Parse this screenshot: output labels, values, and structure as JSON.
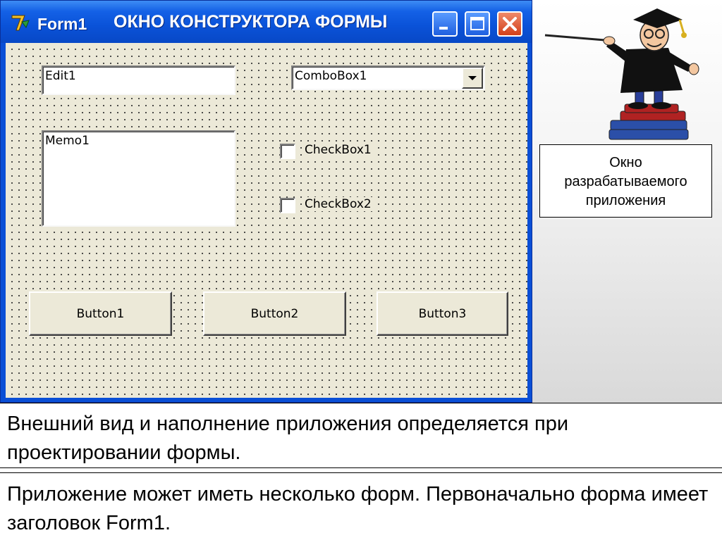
{
  "window": {
    "title": "Form1",
    "caption": "ОКНО КОНСТРУКТОРА ФОРМЫ",
    "colors": {
      "titlebar": "#0a52d8",
      "client": "#ece9d8",
      "close": "#d2401a"
    }
  },
  "form": {
    "edit1": "Edit1",
    "combobox1": "ComboBox1",
    "memo1": "Memo1",
    "checkbox1": "CheckBox1",
    "checkbox2": "CheckBox2",
    "button1": "Button1",
    "button2": "Button2",
    "button3": "Button3"
  },
  "callout": {
    "lines": [
      "Окно",
      "разрабатываемого",
      "приложения"
    ]
  },
  "notes": {
    "para1": "Внешний вид и наполнение приложения определяется при проектировании формы.",
    "para2": "Приложение может иметь несколько форм. Первоначально форма имеет заголовок Form1."
  },
  "icons": [
    "delphi-app-icon",
    "minimize-icon",
    "maximize-icon",
    "close-icon",
    "dropdown-arrow-icon",
    "professor-illustration"
  ]
}
